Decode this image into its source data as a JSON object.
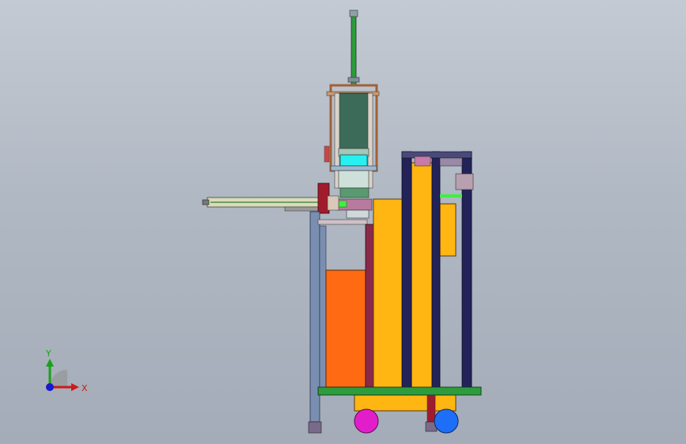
{
  "viewport": {
    "background_top": "#c3cad3",
    "background_bottom": "#a3acb8"
  },
  "model": {
    "parts": [
      "vertical-rod",
      "top-frame",
      "cylinder-block",
      "cyan-plate",
      "side-arm",
      "orange-panel",
      "yellow-panel",
      "navy-columns",
      "green-base",
      "magenta-wheel",
      "blue-wheel"
    ],
    "colors": {
      "orange": "#ff6a13",
      "yellow": "#ffb612",
      "navy": "#23235a",
      "green": "#2d9c3c",
      "magenta": "#e21ecb",
      "blue": "#1f6ef7",
      "cyan": "#27f0f0",
      "frame": "#a0613a",
      "slate": "#7a8fb0"
    }
  },
  "triad": {
    "x_label": "X",
    "y_label": "Y",
    "x_color": "#d01818",
    "y_color": "#19a019",
    "z_color": "#1818d0"
  }
}
